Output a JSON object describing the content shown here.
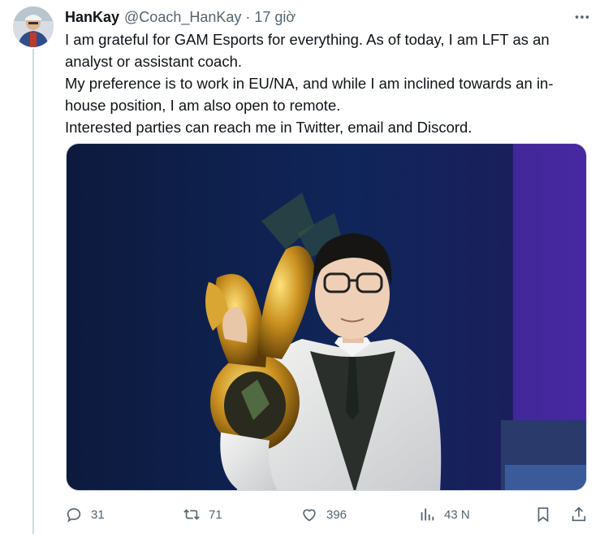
{
  "tweet": {
    "author_name": "HanKay",
    "handle": "@Coach_HanKay",
    "separator": "·",
    "time": "17 giờ",
    "lines": [
      "I am grateful for GAM Esports for everything. As of today, I am LFT as an",
      "analyst or assistant coach.",
      "My preference is to work in EU/NA, and while I am inclined towards an in-",
      "house position, I am also open to remote.",
      "Interested parties can reach me in Twitter, email and Discord."
    ]
  },
  "actions": {
    "reply_count": "31",
    "retweet_count": "71",
    "like_count": "396",
    "views_count": "43 N"
  },
  "icons": {
    "more": "more-horizontal-icon",
    "reply": "reply-icon",
    "retweet": "retweet-icon",
    "like": "heart-icon",
    "views": "views-icon",
    "bookmark": "bookmark-icon",
    "share": "share-icon"
  },
  "colors": {
    "text": "#0f1419",
    "secondary": "#536471",
    "thread_line": "#cfd9de"
  }
}
